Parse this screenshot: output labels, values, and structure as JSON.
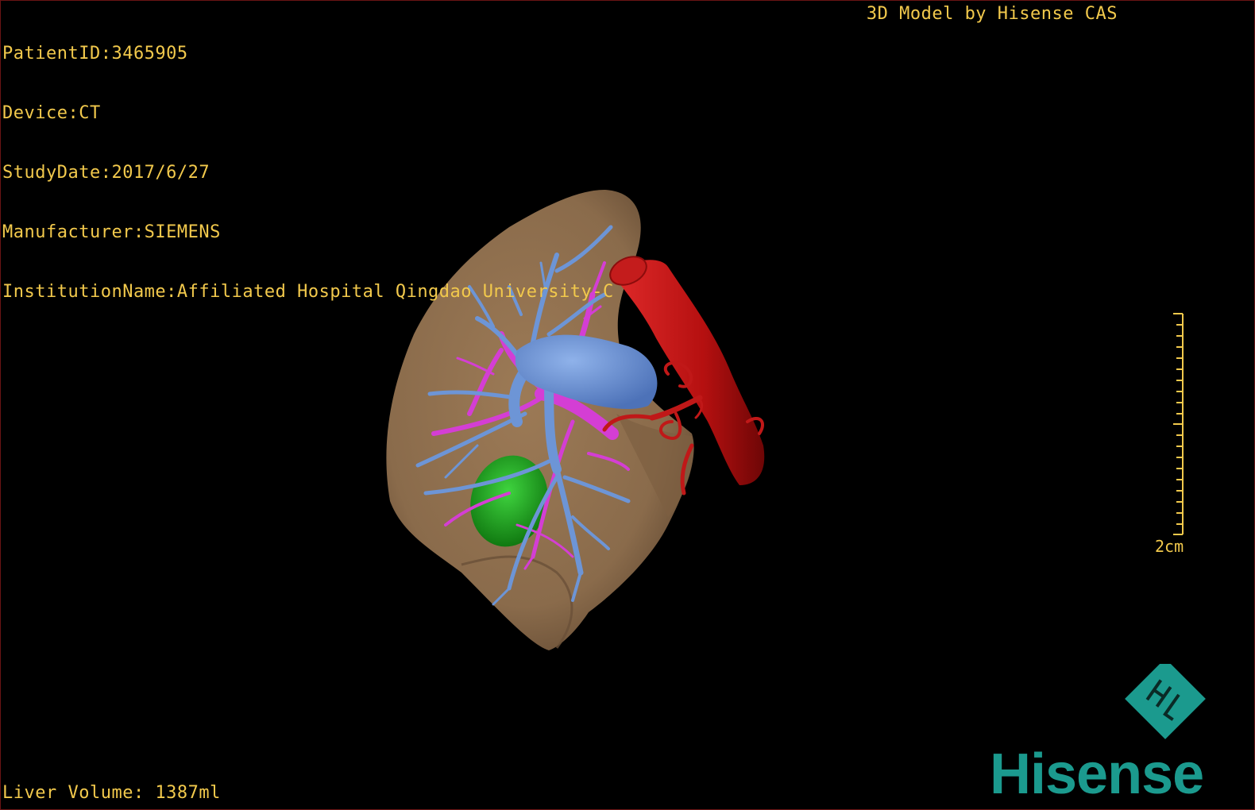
{
  "overlay": {
    "patient_id": "PatientID:3465905",
    "device": "Device:CT",
    "study_date": "StudyDate:2017/6/27",
    "manufacturer": "Manufacturer:SIEMENS",
    "institution": "InstitutionName:Affiliated Hospital Qingdao University-C",
    "credit": "3D Model by Hisense CAS",
    "liver_volume": "Liver Volume: 1387ml"
  },
  "scale": {
    "label": "2cm"
  },
  "logo": {
    "brand": "Hisense",
    "emblem_icon": "hisense-diamond-icon"
  },
  "colors": {
    "overlay_text": "#f2c94c",
    "liver": "#8c6e4e",
    "portal_vein": "#6d95d6",
    "hepatic_vein": "#d43ed4",
    "artery": "#b81515",
    "gallbladder": "#1fa81f",
    "brand": "#1b9a8e"
  }
}
